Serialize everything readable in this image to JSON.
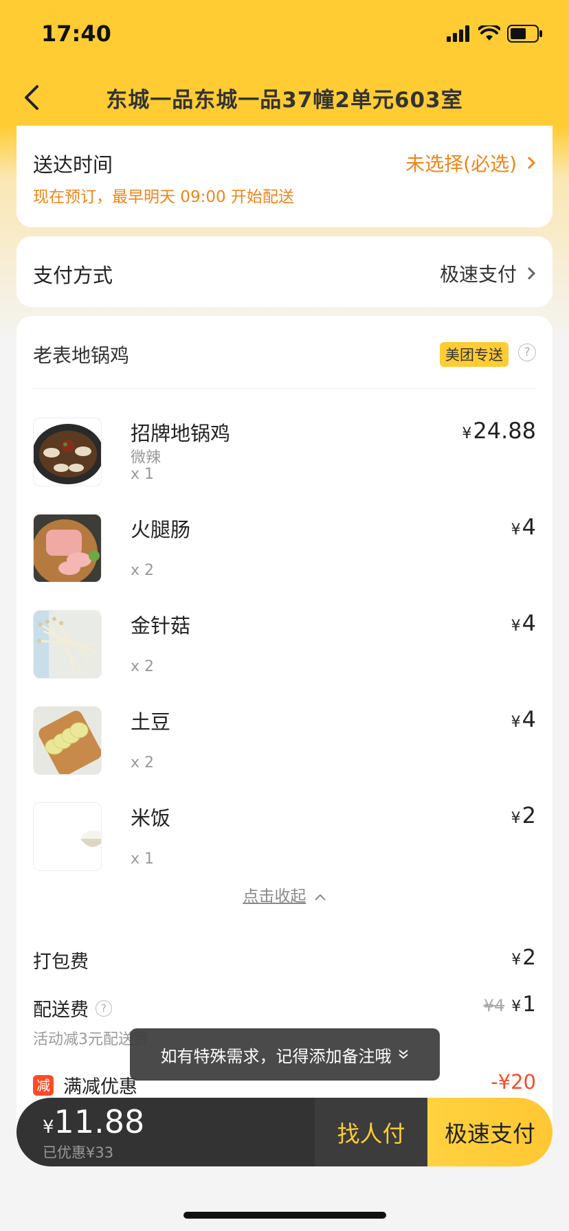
{
  "status_bar": {
    "time": "17:40"
  },
  "header": {
    "title": "东城一品东城一品37幢2单元603室"
  },
  "delivery": {
    "label": "送达时间",
    "value": "未选择(必选)",
    "note": "现在预订，最早明天 09:00 开始配送"
  },
  "payment": {
    "label": "支付方式",
    "value": "极速支付"
  },
  "store": {
    "name": "老表地锅鸡",
    "badge": "美团专送",
    "help_icon": "?"
  },
  "items": [
    {
      "name": "招牌地锅鸡",
      "spec": "微辣",
      "qty": "x 1",
      "currency": "¥",
      "price": "24.88",
      "image": "dish-chicken"
    },
    {
      "name": "火腿肠",
      "spec": "",
      "qty": "x 2",
      "currency": "¥",
      "price": "4",
      "image": "ham"
    },
    {
      "name": "金针菇",
      "spec": "",
      "qty": "x 2",
      "currency": "¥",
      "price": "4",
      "image": "enoki"
    },
    {
      "name": "土豆",
      "spec": "",
      "qty": "x 2",
      "currency": "¥",
      "price": "4",
      "image": "potato"
    },
    {
      "name": "米饭",
      "spec": "",
      "qty": "x 1",
      "currency": "¥",
      "price": "2",
      "image": "rice"
    }
  ],
  "collapse": {
    "label": "点击收起"
  },
  "fees": {
    "packing": {
      "label": "打包费",
      "currency": "¥",
      "value": "2"
    },
    "delivery": {
      "label": "配送费",
      "original": "¥4",
      "currency": "¥",
      "value": "1",
      "note": "活动减3元配送费"
    },
    "discount": {
      "tag": "减",
      "label": "满减优惠",
      "value": "-¥20"
    }
  },
  "toast": {
    "text": "如有特殊需求，记得添加备注哦"
  },
  "bottom": {
    "currency": "¥",
    "total": "11.88",
    "saved": "已优惠¥33",
    "friend_pay": "找人付",
    "pay": "极速支付"
  },
  "colors": {
    "brand": "#ffcc33",
    "accent": "#f08519",
    "red": "#ff4a26"
  }
}
